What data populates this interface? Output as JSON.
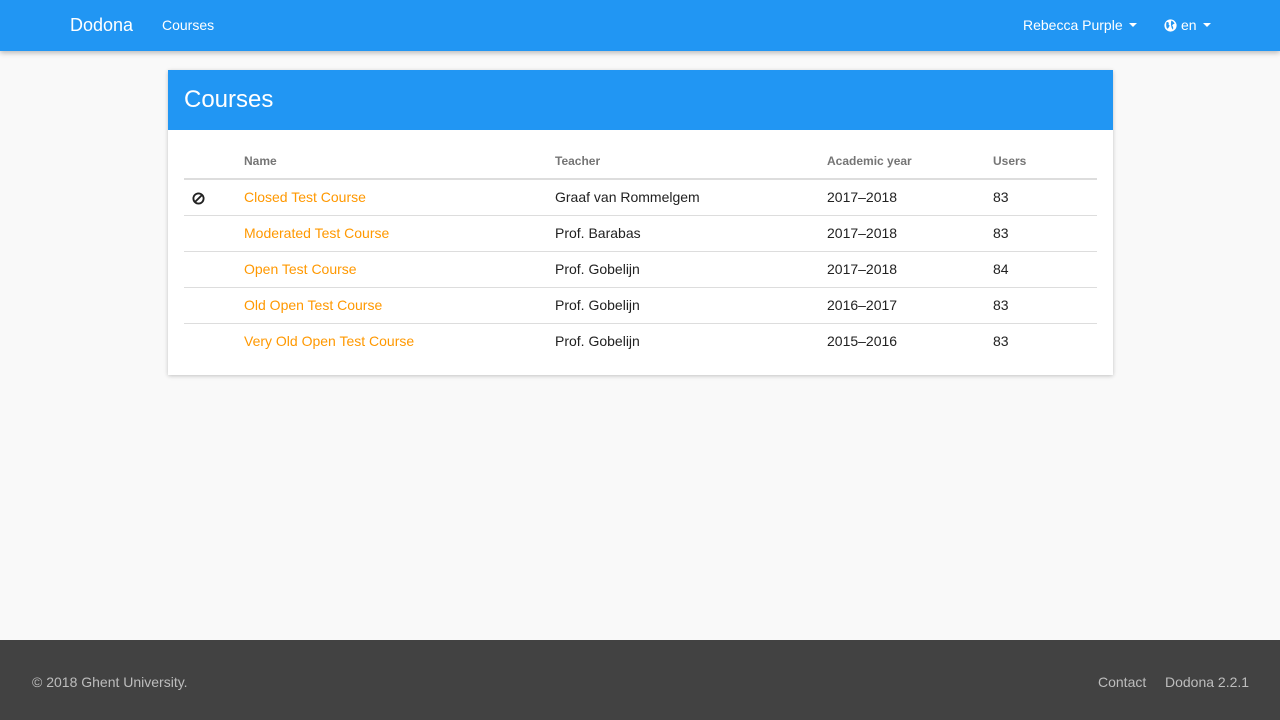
{
  "navbar": {
    "brand": "Dodona",
    "courses_link": "Courses",
    "user_name": "Rebecca Purple",
    "language": "en",
    "color": "#2196f3"
  },
  "card": {
    "title": "Courses"
  },
  "table": {
    "headers": [
      "",
      "Name",
      "Teacher",
      "Academic year",
      "Users"
    ],
    "rows": [
      {
        "status_icon": "ban-icon",
        "name": "Closed Test Course",
        "teacher": "Graaf van Rommelgem",
        "year": "2017–2018",
        "users": "83"
      },
      {
        "status_icon": "",
        "name": "Moderated Test Course",
        "teacher": "Prof. Barabas",
        "year": "2017–2018",
        "users": "83"
      },
      {
        "status_icon": "",
        "name": "Open Test Course",
        "teacher": "Prof. Gobelijn",
        "year": "2017–2018",
        "users": "84"
      },
      {
        "status_icon": "",
        "name": "Old Open Test Course",
        "teacher": "Prof. Gobelijn",
        "year": "2016–2017",
        "users": "83"
      },
      {
        "status_icon": "",
        "name": "Very Old Open Test Course",
        "teacher": "Prof. Gobelijn",
        "year": "2015–2016",
        "users": "83"
      }
    ]
  },
  "footer": {
    "copyright": "© 2018 Ghent University.",
    "contact": "Contact",
    "version": "Dodona 2.2.1"
  },
  "colors": {
    "primary": "#2196f3",
    "link": "#ff9800",
    "footer_bg": "#424242"
  }
}
